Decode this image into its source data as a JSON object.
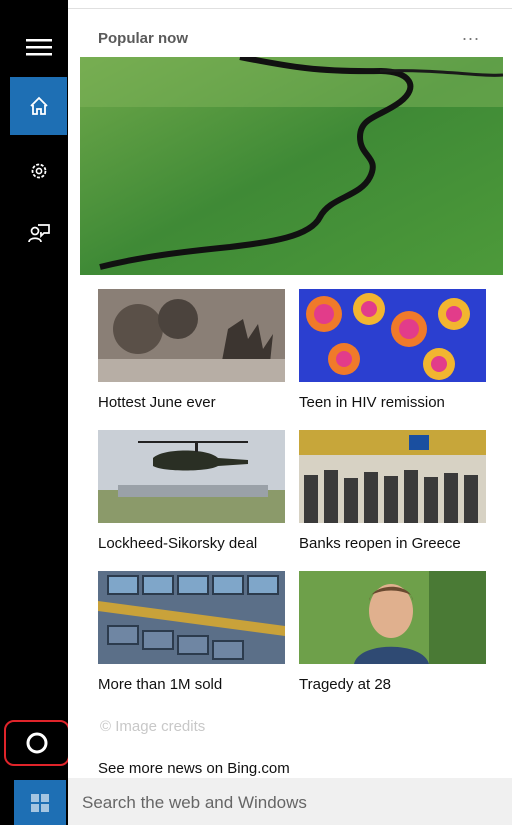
{
  "rail": {
    "items": [
      {
        "icon": "menu-icon"
      },
      {
        "icon": "home-icon",
        "active": true
      },
      {
        "icon": "gear-icon"
      },
      {
        "icon": "feedback-icon"
      }
    ],
    "cortana_icon": "cortana-circle-icon",
    "start_icon": "windows-logo-icon",
    "accent": "#1e6fb4",
    "highlight": "#e0242a"
  },
  "feed": {
    "title": "Popular now",
    "more": "...",
    "tiles": [
      {
        "label": "Hottest June ever"
      },
      {
        "label": "Teen in HIV remission"
      },
      {
        "label": "Lockheed-Sikorsky deal"
      },
      {
        "label": "Banks reopen in Greece"
      },
      {
        "label": "More than 1M sold"
      },
      {
        "label": "Tragedy at 28"
      }
    ],
    "credits": "© Image credits",
    "see_more": "See more news on Bing.com"
  },
  "search": {
    "placeholder": "Search the web and Windows"
  }
}
